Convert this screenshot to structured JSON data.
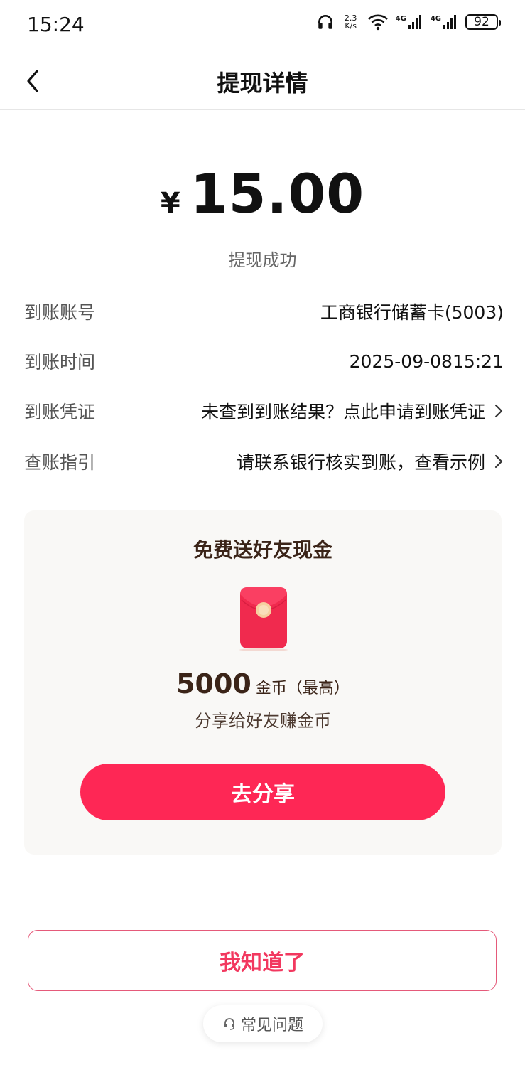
{
  "status_bar": {
    "time": "15:24",
    "net_speed_value": "2.3",
    "net_speed_unit": "K/s",
    "signal_1_label": "4G",
    "signal_2_label": "4G",
    "battery": "92",
    "icons": [
      "headphones-icon",
      "wifi-icon",
      "signal-icon",
      "battery-icon"
    ]
  },
  "nav": {
    "title": "提现详情",
    "back_icon": "chevron-left-icon"
  },
  "summary": {
    "currency": "¥",
    "amount": "15.00",
    "status": "提现成功"
  },
  "details": [
    {
      "label": "到账账号",
      "value": "工商银行储蓄卡(5003)"
    },
    {
      "label": "到账时间",
      "value": "2025-09-0815:21"
    },
    {
      "label": "到账凭证",
      "value": "未查到到账结果？点此申请到账凭证"
    },
    {
      "label": "查账指引",
      "value": "请联系银行核实到账，查看示例"
    }
  ],
  "promo": {
    "title": "免费送好友现金",
    "coin_amount": "5000",
    "coin_unit": "金币（最高）",
    "subtitle": "分享给好友赚金币",
    "share_label": "去分享",
    "envelope_icon": "red-envelope-icon"
  },
  "footer": {
    "ok_label": "我知道了",
    "faq_label": "常见问题",
    "faq_icon": "headset-icon"
  },
  "colors": {
    "accent": "#fe2755",
    "ok_text": "#f2385f",
    "promo_text": "#3b2418",
    "card_bg": "#f9f8f6"
  }
}
